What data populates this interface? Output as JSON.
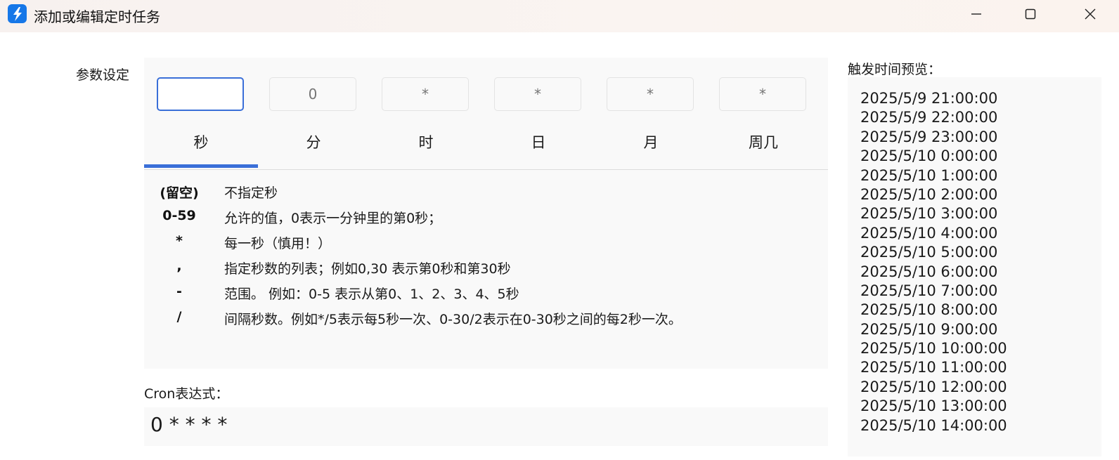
{
  "window": {
    "title": "添加或编辑定时任务",
    "icon": "lightning-icon",
    "accent_color": "#1677e8"
  },
  "params": {
    "label": "参数设定",
    "fields": [
      {
        "name": "second",
        "value": "",
        "placeholder": "",
        "tab_label": "秒",
        "active": true
      },
      {
        "name": "minute",
        "value": "",
        "placeholder": "0",
        "tab_label": "分",
        "active": false
      },
      {
        "name": "hour",
        "value": "",
        "placeholder": "*",
        "tab_label": "时",
        "active": false
      },
      {
        "name": "day",
        "value": "",
        "placeholder": "*",
        "tab_label": "日",
        "active": false
      },
      {
        "name": "month",
        "value": "",
        "placeholder": "*",
        "tab_label": "月",
        "active": false
      },
      {
        "name": "weekday",
        "value": "",
        "placeholder": "*",
        "tab_label": "周几",
        "active": false
      }
    ],
    "active_color": "#3a6fd8",
    "help": [
      {
        "symbol": "(留空)",
        "desc": "不指定秒"
      },
      {
        "symbol": "0-59",
        "desc": "允许的值，0表示一分钟里的第0秒；"
      },
      {
        "symbol": "*",
        "desc": "每一秒（慎用！）"
      },
      {
        "symbol": ",",
        "desc": "指定秒数的列表；例如0,30 表示第0秒和第30秒"
      },
      {
        "symbol": "-",
        "desc": "范围。 例如：0-5 表示从第0、1、2、3、4、5秒"
      },
      {
        "symbol": "/",
        "desc": "间隔秒数。例如*/5表示每5秒一次、0-30/2表示在0-30秒之间的每2秒一次。"
      }
    ]
  },
  "cron": {
    "label": "Cron表达式：",
    "expression": "0 * * * *"
  },
  "preview": {
    "label": "触发时间预览：",
    "times": [
      "2025/5/9 21:00:00",
      "2025/5/9 22:00:00",
      "2025/5/9 23:00:00",
      "2025/5/10 0:00:00",
      "2025/5/10 1:00:00",
      "2025/5/10 2:00:00",
      "2025/5/10 3:00:00",
      "2025/5/10 4:00:00",
      "2025/5/10 5:00:00",
      "2025/5/10 6:00:00",
      "2025/5/10 7:00:00",
      "2025/5/10 8:00:00",
      "2025/5/10 9:00:00",
      "2025/5/10 10:00:00",
      "2025/5/10 11:00:00",
      "2025/5/10 12:00:00",
      "2025/5/10 13:00:00",
      "2025/5/10 14:00:00"
    ]
  }
}
